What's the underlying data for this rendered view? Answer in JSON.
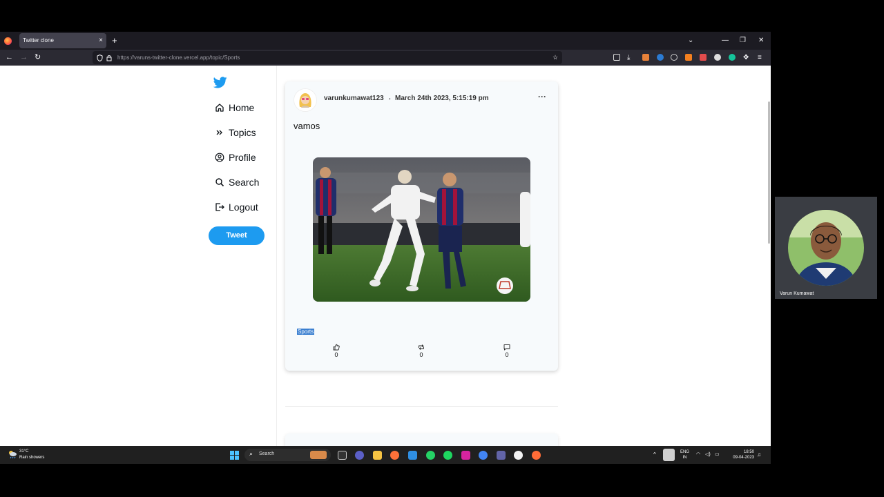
{
  "browser": {
    "tab_title": "Twitter clone",
    "tab_close": "×",
    "new_tab": "+",
    "url": "https://varuns-twitter-clone.vercel.app/topic/Sports"
  },
  "sidebar": {
    "items": [
      {
        "label": "Home",
        "icon": "home-icon"
      },
      {
        "label": "Topics",
        "icon": "chevrons-right-icon"
      },
      {
        "label": "Profile",
        "icon": "user-circle-icon"
      },
      {
        "label": "Search",
        "icon": "search-icon"
      },
      {
        "label": "Logout",
        "icon": "logout-icon"
      }
    ],
    "tweet_button": "Tweet",
    "brand_color": "#1d9bf0"
  },
  "post": {
    "username": "varunkumawat123",
    "separator": ".",
    "datetime": "March 24th 2023, 5:15:19 pm",
    "more": "···",
    "text": "vamos",
    "tag": "Sports",
    "likes": "0",
    "retweets": "0",
    "comments": "0"
  },
  "webcam": {
    "name": "Varun Kumawat"
  },
  "taskbar": {
    "weather_temp": "31°C",
    "weather_desc": "Rain showers",
    "search_placeholder": "Search",
    "lang_line1": "ENG",
    "lang_line2": "IN",
    "time": "18:50",
    "date": "09-04-2023"
  }
}
